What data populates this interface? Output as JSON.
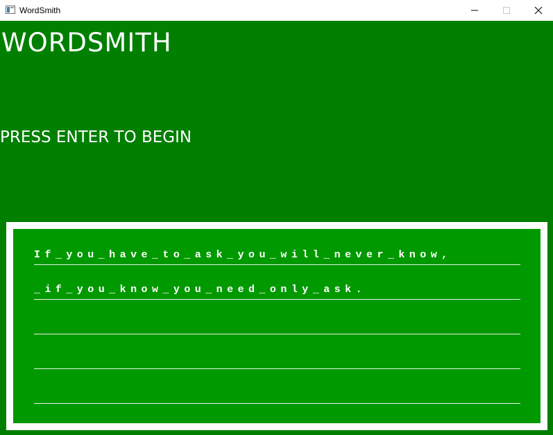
{
  "window": {
    "title": "WordSmith",
    "app_icon": "window-app-icon",
    "controls": {
      "minimize_icon": "minimize-icon",
      "maximize_icon": "maximize-icon",
      "close_icon": "close-icon"
    }
  },
  "game": {
    "title": "WORDSMITH",
    "prompt": "PRESS ENTER TO BEGIN",
    "board_lines": [
      "If_you_have_to_ask_you_will_never_know,",
      "_if_you_know_you_need_only_ask.",
      "",
      "",
      ""
    ]
  },
  "colors": {
    "background": "#007f00",
    "board": "#009900",
    "frame": "#ffffff",
    "text": "#ffffff"
  }
}
